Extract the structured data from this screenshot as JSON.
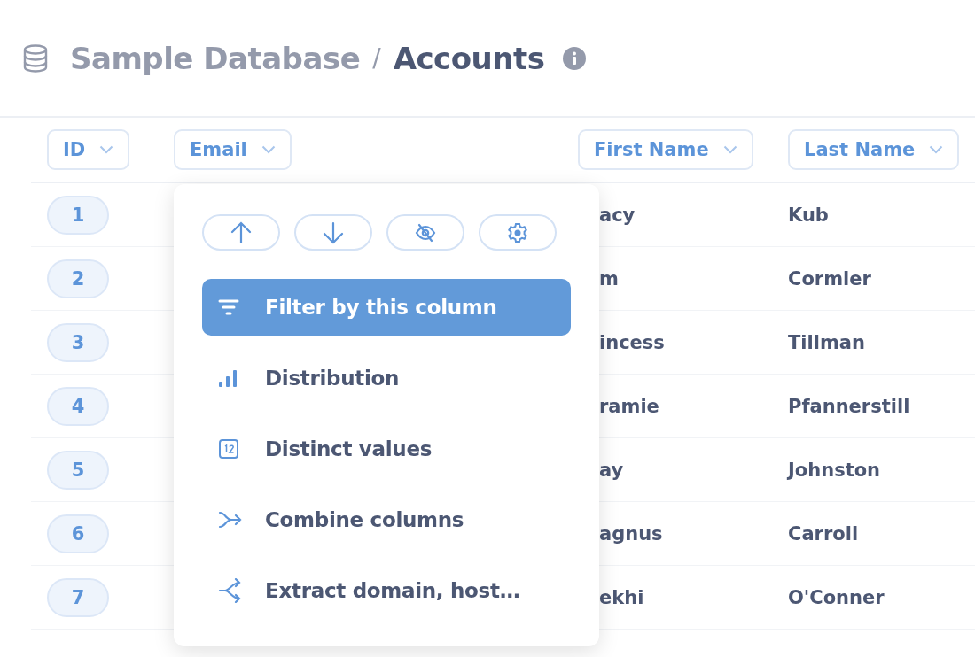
{
  "breadcrumb": {
    "database": "Sample Database",
    "separator": "/",
    "table": "Accounts"
  },
  "columns": [
    {
      "label": "ID"
    },
    {
      "label": "Email"
    },
    {
      "label": "First Name"
    },
    {
      "label": "Last Name"
    }
  ],
  "rows": [
    {
      "id": "1",
      "first_name": "acy",
      "last_name": "Kub"
    },
    {
      "id": "2",
      "first_name": "m",
      "last_name": "Cormier"
    },
    {
      "id": "3",
      "first_name": "incess",
      "last_name": "Tillman"
    },
    {
      "id": "4",
      "first_name": "ramie",
      "last_name": "Pfannerstill"
    },
    {
      "id": "5",
      "first_name": "ay",
      "last_name": "Johnston"
    },
    {
      "id": "6",
      "first_name": "agnus",
      "last_name": "Carroll"
    },
    {
      "id": "7",
      "first_name": "ekhi",
      "last_name": "O'Conner"
    }
  ],
  "column_menu": {
    "actions": [
      {
        "kind": "sort-ascending"
      },
      {
        "kind": "sort-descending"
      },
      {
        "kind": "hide"
      },
      {
        "kind": "settings"
      }
    ],
    "items": [
      {
        "kind": "filter",
        "label": "Filter by this column",
        "selected": true
      },
      {
        "kind": "distribution",
        "label": "Distribution",
        "selected": false
      },
      {
        "kind": "distinct",
        "label": "Distinct values",
        "selected": false
      },
      {
        "kind": "combine",
        "label": "Combine columns",
        "selected": false
      },
      {
        "kind": "extract",
        "label": "Extract domain, host…",
        "selected": false
      }
    ]
  }
}
